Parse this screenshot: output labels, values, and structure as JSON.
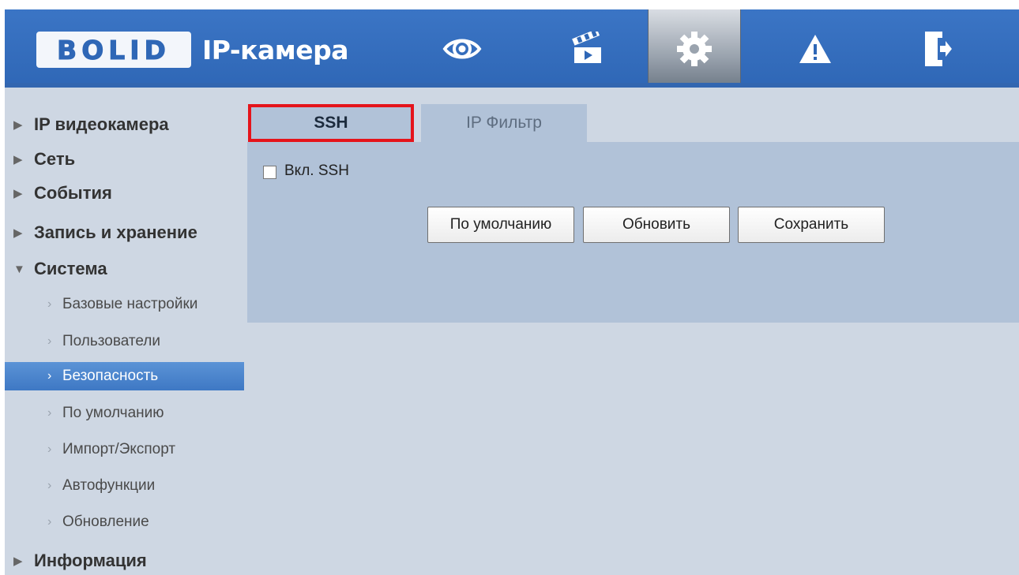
{
  "header": {
    "logo_text": "BOLID",
    "title": "IP-камера",
    "nav": [
      {
        "icon": "eye-icon",
        "active": false
      },
      {
        "icon": "clapperboard-icon",
        "active": false
      },
      {
        "icon": "gear-icon",
        "active": true
      },
      {
        "icon": "warning-icon",
        "active": false
      },
      {
        "icon": "logout-icon",
        "active": false
      }
    ]
  },
  "sidebar": {
    "sections": [
      {
        "label": "IP видеокамера",
        "expanded": false
      },
      {
        "label": "Сеть",
        "expanded": false
      },
      {
        "label": "События",
        "expanded": false
      },
      {
        "label": "Запись и хранение",
        "expanded": false
      },
      {
        "label": "Система",
        "expanded": true
      },
      {
        "label": "Информация",
        "expanded": false
      }
    ],
    "items": [
      {
        "label": "Базовые настройки",
        "selected": false
      },
      {
        "label": "Пользователи",
        "selected": false
      },
      {
        "label": "Безопасность",
        "selected": true
      },
      {
        "label": "По умолчанию",
        "selected": false
      },
      {
        "label": "Импорт/Экспорт",
        "selected": false
      },
      {
        "label": "Автофункции",
        "selected": false
      },
      {
        "label": "Обновление",
        "selected": false
      }
    ]
  },
  "main": {
    "tabs": [
      {
        "label": "SSH",
        "active": true
      },
      {
        "label": "IP Фильтр",
        "active": false
      }
    ],
    "ssh": {
      "label": "Вкл. SSH",
      "checked": false
    },
    "buttons": {
      "default": "По умолчанию",
      "refresh": "Обновить",
      "save": "Сохранить"
    }
  },
  "colors": {
    "header_blue": "#2f67b6",
    "panel_bg": "#b1c2d8",
    "page_bg": "#ced7e3",
    "highlight": "#e5141b",
    "selected_item": "#3e78c4"
  }
}
